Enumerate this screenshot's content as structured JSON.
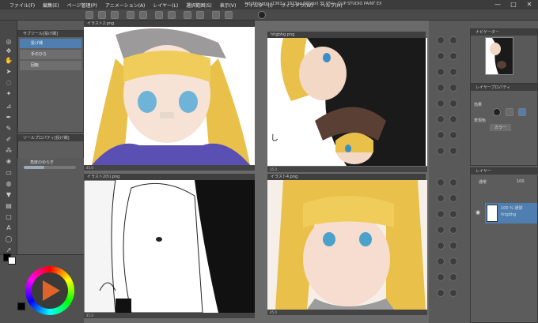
{
  "app": {
    "title": "hitgbhg.png (1367 x 1823px 600dpi) 35.0%) - CLIP STUDIO PAINT EX"
  },
  "menu": [
    {
      "label": "ファイル(F)"
    },
    {
      "label": "編集(E)"
    },
    {
      "label": "ページ管理(P)"
    },
    {
      "label": "アニメーション(A)"
    },
    {
      "label": "レイヤー(L)"
    },
    {
      "label": "選択範囲(S)"
    },
    {
      "label": "表示(V)"
    },
    {
      "label": "フィルター(I)"
    },
    {
      "label": "ウィンドウ(W)"
    },
    {
      "label": "ヘルプ(H)"
    }
  ],
  "window_controls": {
    "minimize": "—",
    "maximize": "□",
    "close": "✕"
  },
  "subtool": {
    "tab_label": "サブツール[投げ縄]",
    "items": [
      {
        "label": "投げ縄",
        "active": true
      },
      {
        "label": "手のひら",
        "active": false
      },
      {
        "label": "回転",
        "active": false
      }
    ]
  },
  "tool_property": {
    "tab_label": "ツールプロパティ[投げ縄]"
  },
  "brush_size": {
    "label": "角度のゆらぎ"
  },
  "views": [
    {
      "tab": "イラスト2.png",
      "status": "45.0"
    },
    {
      "tab": "hitgbhg.png",
      "status": "35.0"
    },
    {
      "tab": "イラスト2(h).png",
      "status": "45.0"
    },
    {
      "tab": "イラスト4.png",
      "status": "45.0"
    }
  ],
  "navigator": {
    "tab_label": "ナビゲーター"
  },
  "layer_property": {
    "tab_label": "レイヤープロパティ",
    "effect_label": "効果",
    "express_label": "表現色",
    "color_value": "カラー"
  },
  "layer_panel": {
    "tab_label": "レイヤー",
    "blend_mode": "通常",
    "opacity": "100",
    "layers": [
      {
        "line1": "100 % 通常",
        "line2": "hitgbhg"
      }
    ]
  },
  "colors": {
    "accent_blue": "#4f7fb0",
    "main_color": "#000000",
    "sub_color": "#ffffff"
  },
  "icons": [
    "hand-icon",
    "zoom-icon",
    "lasso-icon",
    "pen-icon",
    "brush-icon",
    "eraser-icon",
    "fill-icon",
    "text-icon",
    "eye-icon",
    "gear-icon"
  ]
}
